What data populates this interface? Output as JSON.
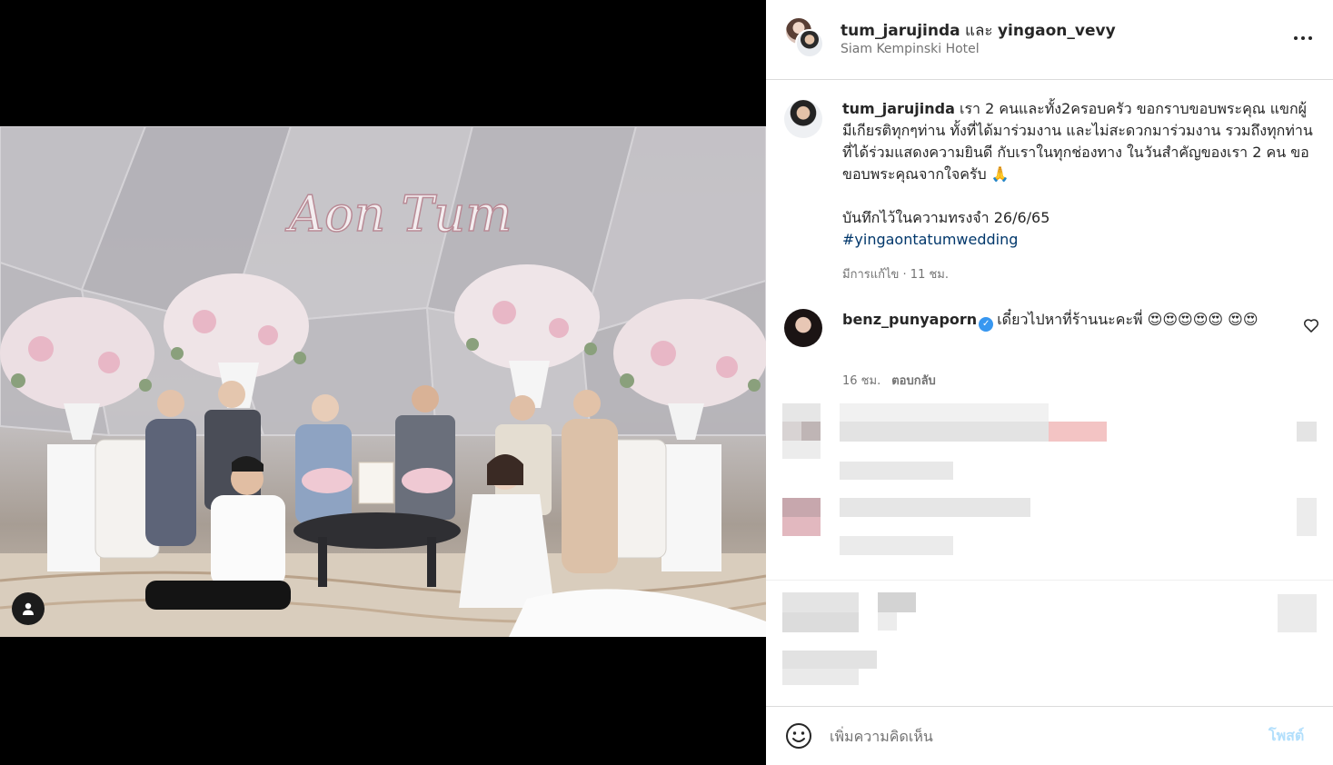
{
  "header": {
    "author1": "tum_jarujinda",
    "joiner": " และ ",
    "author2": "yingaon_vevy",
    "location": "Siam Kempinski Hotel"
  },
  "caption": {
    "username": "tum_jarujinda",
    "text": " เรา 2 คนและทั้ง2ครอบครัว ขอกราบขอบพระคุณ แขกผู้มีเกียรติทุกๆท่าน ทั้งที่ได้มาร่วมงาน และไม่สะดวกมาร่วมงาน รวมถึงทุกท่านที่ได้ร่วมแสดงความยินดี กับเราในทุกช่องทาง ในวันสำคัญของเรา 2 คน ขอขอบพระคุณจากใจครับ 🙏",
    "line2": "บันทึกไว้ในความทรงจำ 26/6/65",
    "hashtag": "#yingaontatumwedding",
    "meta": "มีการแก้ไข · 11 ชม."
  },
  "comment": {
    "username": "benz_punyaporn",
    "verified_icon": "✓",
    "text": "เดี๋ยวไปหาที่ร้านนะคะพี่ 😍😍😍😍😍 😍😍",
    "time": "16 ชม.",
    "reply": "ตอบกลับ"
  },
  "photo": {
    "sign_text": "Aon Tum"
  },
  "add_comment": {
    "placeholder": "เพิ่มความคิดเห็น",
    "post_label": "โพสต์"
  },
  "icons": {
    "more": "more-horizontal-icon",
    "heart": "heart-outline-icon",
    "emoji": "emoji-smile-icon",
    "user_tag": "user-tag-icon"
  }
}
